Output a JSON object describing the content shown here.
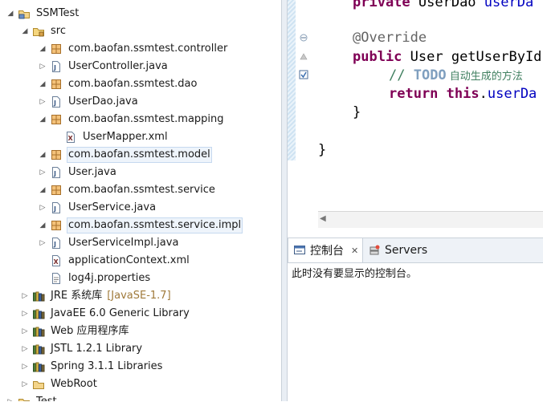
{
  "explorer": {
    "items": [
      {
        "label": "SSMTest",
        "icon": "project-icon",
        "expanded": true
      },
      {
        "label": "src",
        "icon": "source-folder-icon",
        "expanded": true
      },
      {
        "label": "com.baofan.ssmtest.controller",
        "icon": "package-icon",
        "expanded": true
      },
      {
        "label": "UserController.java",
        "icon": "java-file-icon",
        "expanded": false
      },
      {
        "label": "com.baofan.ssmtest.dao",
        "icon": "package-icon",
        "expanded": true
      },
      {
        "label": "UserDao.java",
        "icon": "java-file-icon",
        "expanded": false
      },
      {
        "label": "com.baofan.ssmtest.mapping",
        "icon": "package-icon",
        "expanded": true
      },
      {
        "label": "UserMapper.xml",
        "icon": "xml-file-icon"
      },
      {
        "label": "com.baofan.ssmtest.model",
        "icon": "package-icon",
        "expanded": true
      },
      {
        "label": "User.java",
        "icon": "java-file-icon",
        "expanded": false
      },
      {
        "label": "com.baofan.ssmtest.service",
        "icon": "package-icon",
        "expanded": true
      },
      {
        "label": "UserService.java",
        "icon": "java-file-icon",
        "expanded": false
      },
      {
        "label": "com.baofan.ssmtest.service.impl",
        "icon": "package-icon",
        "expanded": true
      },
      {
        "label": "UserServiceImpl.java",
        "icon": "java-file-icon",
        "expanded": false
      },
      {
        "label": "applicationContext.xml",
        "icon": "xml-file-icon"
      },
      {
        "label": "log4j.properties",
        "icon": "properties-file-icon"
      },
      {
        "label": "JRE 系统库",
        "suffix": "[JavaSE-1.7]",
        "icon": "library-icon",
        "expanded": false
      },
      {
        "label": "JavaEE 6.0 Generic Library",
        "icon": "library-icon",
        "expanded": false
      },
      {
        "label": "Web 应用程序库",
        "icon": "library-icon",
        "expanded": false
      },
      {
        "label": "JSTL 1.2.1 Library",
        "icon": "library-icon",
        "expanded": false
      },
      {
        "label": "Spring 3.1.1 Libraries",
        "icon": "library-icon",
        "expanded": false
      },
      {
        "label": "WebRoot",
        "icon": "folder-icon",
        "expanded": false
      },
      {
        "label": "Test",
        "icon": "project-icon",
        "expanded": false
      }
    ]
  },
  "editor": {
    "code": [
      {
        "parts": [
          [
            "kw",
            "private"
          ],
          [
            "plain",
            " UserDao "
          ],
          [
            "fld",
            "userDa"
          ]
        ]
      },
      {
        "parts": []
      },
      {
        "parts": [
          [
            "ann",
            "@Override"
          ]
        ]
      },
      {
        "parts": [
          [
            "kw",
            "public"
          ],
          [
            "plain",
            " User getUserById"
          ]
        ]
      },
      {
        "parts": [
          [
            "cmt",
            "// "
          ],
          [
            "todo",
            "TODO"
          ],
          [
            "cmt-cn",
            " 自动生成的方法"
          ]
        ]
      },
      {
        "parts": [
          [
            "kw",
            "return"
          ],
          [
            "plain",
            " "
          ],
          [
            "kw",
            "this"
          ],
          [
            "plain",
            "."
          ],
          [
            "fld",
            "userDa"
          ]
        ]
      },
      {
        "parts": [
          [
            "plain",
            "}"
          ]
        ]
      },
      {
        "parts": []
      },
      {
        "parts": [
          [
            "plain",
            "}"
          ]
        ]
      }
    ]
  },
  "console": {
    "tabs": [
      {
        "label": "控制台",
        "icon": "console-icon",
        "active": true
      },
      {
        "label": "Servers",
        "icon": "servers-icon",
        "active": false
      }
    ],
    "close_glyph": "✕",
    "message": "此时没有要显示的控制台。"
  },
  "colors": {
    "keyword": "#7f0055",
    "annotation": "#646464",
    "comment": "#3f7f5f",
    "field": "#0000c0",
    "selection": "#eef4fb"
  }
}
